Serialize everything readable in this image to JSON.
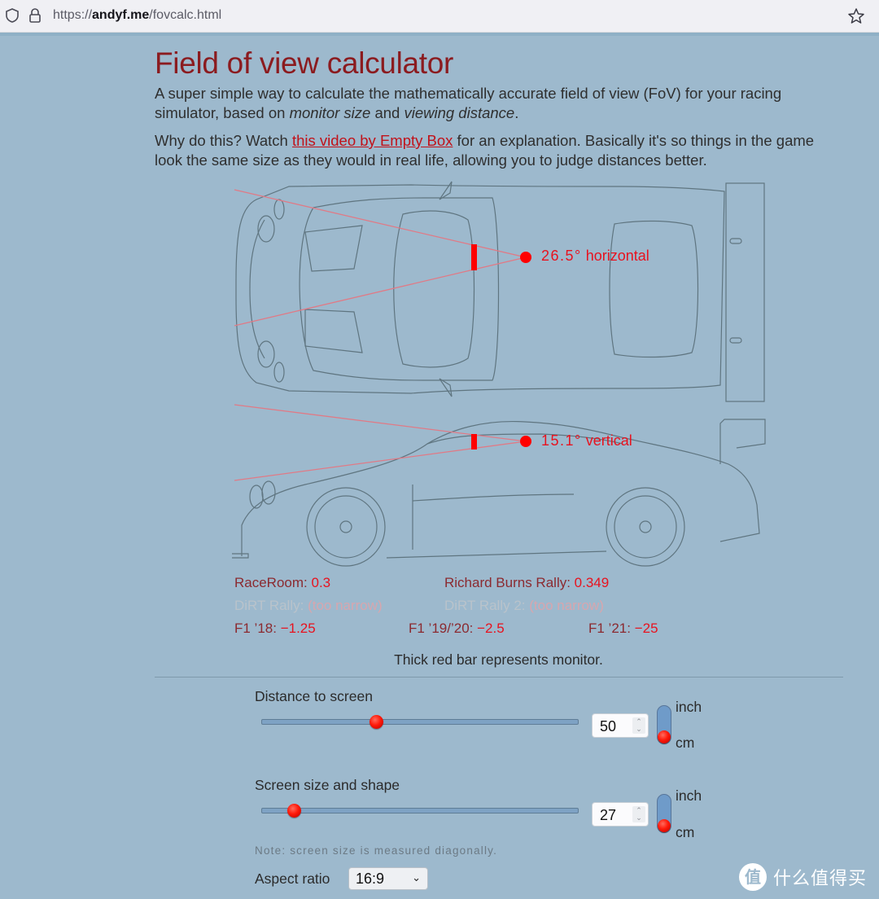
{
  "browser": {
    "url_prefix": "https://",
    "url_domain": "andyf.me",
    "url_path": "/fovcalc.html"
  },
  "page": {
    "title": "Field of view calculator",
    "intro1_a": "A super simple way to calculate the mathematically accurate field of view (FoV) for your racing simulator, based on ",
    "intro1_em1": "monitor size",
    "intro1_b": " and ",
    "intro1_em2": "viewing distance",
    "intro1_c": ".",
    "intro2_a": "Why do this? Watch ",
    "intro2_link": "this video by Empty Box",
    "intro2_b": " for an explanation. Basically it's so things in the game look the same size as they would in real life, allowing you to judge distances better."
  },
  "diagram": {
    "horizontal_fov": "26.5°",
    "horizontal_suffix": " horizontal",
    "vertical_fov": "15.1°",
    "vertical_suffix": " vertical",
    "accent_color": "#e8121e"
  },
  "games": [
    {
      "name": "RaceRoom: ",
      "value": "0.3",
      "enabled": true
    },
    {
      "name": "Richard Burns Rally: ",
      "value": "0.349",
      "enabled": true
    },
    {
      "name": "DiRT Rally: ",
      "value": "(too narrow)",
      "enabled": false
    },
    {
      "name": "DiRT Rally 2: ",
      "value": "(too narrow)",
      "enabled": false
    },
    {
      "name": "F1 ’18: ",
      "value": "−1.25",
      "enabled": true
    },
    {
      "name": "F1 ’19/’20: ",
      "value": "−2.5",
      "enabled": true
    },
    {
      "name": "F1 ’21: ",
      "value": "−25",
      "enabled": true
    }
  ],
  "caption": "Thick red bar represents monitor.",
  "controls": {
    "distance": {
      "label": "Distance to screen",
      "value": "50",
      "slider_fraction": 0.36,
      "unit_top": "inch",
      "unit_bottom": "cm",
      "selected_unit": "cm"
    },
    "screen": {
      "label": "Screen size and shape",
      "value": "27",
      "slider_fraction": 0.1,
      "unit_top": "inch",
      "unit_bottom": "cm",
      "selected_unit": "cm"
    },
    "note": "Note: screen size is measured diagonally.",
    "aspect_label": "Aspect ratio",
    "aspect_value": "16:9"
  },
  "watermark": {
    "logo_char": "值",
    "text": "什么值得买"
  }
}
